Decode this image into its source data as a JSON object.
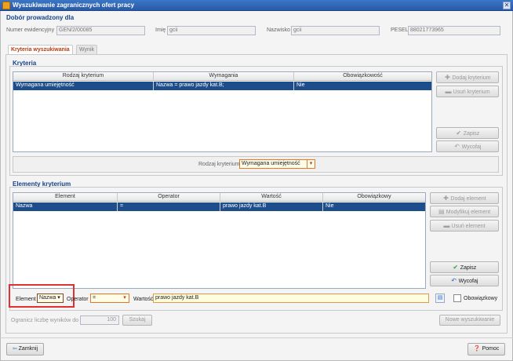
{
  "window": {
    "title": "Wyszukiwanie zagranicznych ofert pracy",
    "close_glyph": "✕"
  },
  "employee": {
    "section_title": "Dobór prowadzony dla",
    "evidence_label": "Numer ewidencyjny",
    "evidence_value": "GEN/2/00085",
    "firstname_label": "Imię",
    "firstname_value": "gcii",
    "lastname_label": "Nazwisko",
    "lastname_value": "gcii",
    "pesel_label": "PESEL",
    "pesel_value": "88021773965"
  },
  "tabs": [
    {
      "label": "Kryteria wyszukiwania",
      "active": true
    },
    {
      "label": "Wynik",
      "active": false
    }
  ],
  "criteria": {
    "section_title": "Kryteria",
    "columns": [
      "Rodzaj kryterium",
      "Wymagania",
      "Obowiązkowość"
    ],
    "rows": [
      [
        "Wymagana umiejętność",
        "Nazwa = prawo jazdy kat.B;",
        "Nie"
      ]
    ],
    "buttons": {
      "add": "Dodaj kryterium",
      "remove": "Usuń kryterium",
      "save": "Zapisz",
      "undo": "Wycofaj"
    },
    "type_label": "Rodzaj kryterium",
    "type_value": "Wymagana umiejętność"
  },
  "elements": {
    "section_title": "Elementy kryterium",
    "columns": [
      "Element",
      "Operator",
      "Wartość",
      "Obowiązkowy"
    ],
    "rows": [
      [
        "Nazwa",
        "=",
        "prawo jazdy kat.B",
        "Nie"
      ]
    ],
    "buttons": {
      "add": "Dodaj element",
      "modify": "Modyfikuj element",
      "remove": "Usuń element",
      "save": "Zapisz",
      "undo": "Wycofaj"
    },
    "element_label": "Element",
    "element_value": "Nazwa",
    "operator_label": "Operator",
    "operator_value": "=",
    "value_label": "Wartość",
    "value_value": "prawo jazdy kat.B",
    "mandatory_label": "Obowiązkowy"
  },
  "limit": {
    "label": "Ogranicz liczbę wyników do",
    "value": "100",
    "search_button": "Szukaj",
    "new_search_button": "Nowe wyszukiwanie"
  },
  "footer": {
    "close_button": "Zamknij",
    "help_button": "Pomoc"
  },
  "colors": {
    "accent": "#1e4d8c",
    "highlight": "#e03030",
    "title": "#15428b"
  }
}
